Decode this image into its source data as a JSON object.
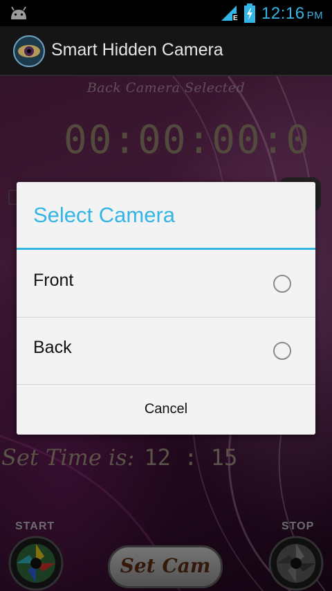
{
  "status_bar": {
    "time": "12:16",
    "ampm": "PM",
    "icons": [
      "android-debug-icon",
      "signal-icon",
      "battery-charging-icon"
    ],
    "accent_color": "#33b5e5"
  },
  "action_bar": {
    "app_title": "Smart Hidden Camera",
    "logo_icon": "eye-camera-logo-icon"
  },
  "main": {
    "camera_status": "Back Camera Selected",
    "timer": "00:00:00:0",
    "set_time_label": "Set Time is:",
    "set_time_value": "12 : 15",
    "start_label": "START",
    "stop_label": "STOP",
    "set_cam_label": "Set Cam"
  },
  "dialog": {
    "title": "Select Camera",
    "options": [
      {
        "label": "Front",
        "selected": false
      },
      {
        "label": "Back",
        "selected": false
      }
    ],
    "cancel_label": "Cancel",
    "accent_color": "#33b5e5"
  }
}
